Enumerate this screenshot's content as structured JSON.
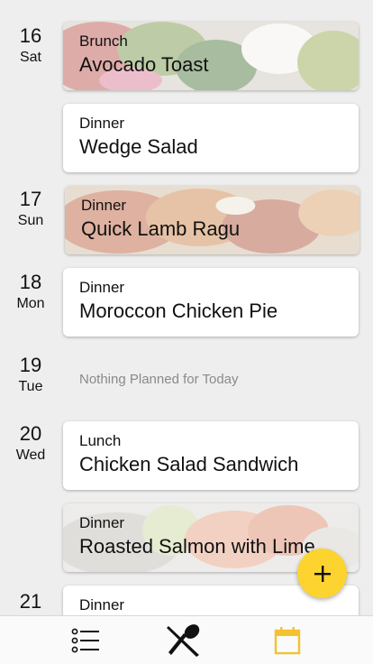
{
  "days": [
    {
      "num": "16",
      "name": "Sat"
    },
    {
      "num": "17",
      "name": "Sun"
    },
    {
      "num": "18",
      "name": "Mon"
    },
    {
      "num": "19",
      "name": "Tue"
    },
    {
      "num": "20",
      "name": "Wed"
    },
    {
      "num": "21",
      "name": ""
    }
  ],
  "meals": [
    {
      "type": "Brunch",
      "title": "Avocado Toast"
    },
    {
      "type": "Dinner",
      "title": "Wedge Salad"
    },
    {
      "type": "Dinner",
      "title": "Quick Lamb Ragu"
    },
    {
      "type": "Dinner",
      "title": "Moroccon Chicken Pie"
    },
    {
      "type": "Lunch",
      "title": "Chicken Salad Sandwich"
    },
    {
      "type": "Dinner",
      "title": "Roasted Salmon with Lime"
    },
    {
      "type": "Dinner",
      "title": ""
    }
  ],
  "empty_day_text": "Nothing Planned for Today",
  "nav": {
    "items": [
      "list-icon",
      "fork-knife-icon",
      "calendar-icon"
    ],
    "active": "calendar-icon"
  },
  "colors": {
    "background": "#eeeeee",
    "accent": "#fdd32f",
    "active_icon": "#f2c230"
  }
}
